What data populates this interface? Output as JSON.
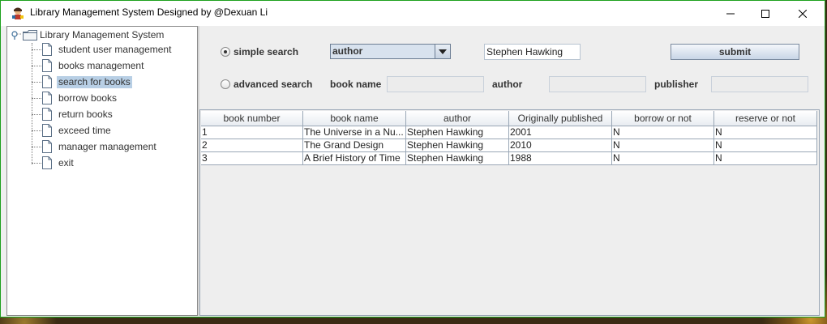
{
  "window": {
    "title": "Library Management System Designed by @Dexuan Li",
    "icon": "librarian-icon",
    "controls": [
      "minimize-icon",
      "maximize-icon",
      "close-icon"
    ]
  },
  "tree": {
    "root_label": "Library Management System",
    "items": [
      {
        "label": "student user management",
        "selected": false
      },
      {
        "label": "books management",
        "selected": false
      },
      {
        "label": "search for books",
        "selected": true
      },
      {
        "label": "borrow books",
        "selected": false
      },
      {
        "label": "return books",
        "selected": false
      },
      {
        "label": "exceed time",
        "selected": false
      },
      {
        "label": "manager management",
        "selected": false
      },
      {
        "label": "exit",
        "selected": false
      }
    ]
  },
  "search": {
    "simple_label": "simple search",
    "simple_selected": true,
    "field_selected": "author",
    "query_value": "Stephen Hawking",
    "submit_label": "submit",
    "advanced_label": "advanced search",
    "advanced_selected": false,
    "book_name_label": "book name",
    "book_name_value": "",
    "author_label": "author",
    "author_value": "",
    "publisher_label": "publisher",
    "publisher_value": ""
  },
  "table": {
    "headers": [
      "book number",
      "book name",
      "author",
      "Originally published",
      "borrow or not",
      "reserve or not"
    ],
    "rows": [
      [
        "1",
        "The Universe in a Nu...",
        "Stephen Hawking",
        "2001",
        "N",
        "N"
      ],
      [
        "2",
        "The Grand Design",
        "Stephen Hawking",
        "2010",
        "N",
        "N"
      ],
      [
        "3",
        "A Brief History of Time",
        "Stephen Hawking",
        "1988",
        "N",
        "N"
      ]
    ]
  }
}
